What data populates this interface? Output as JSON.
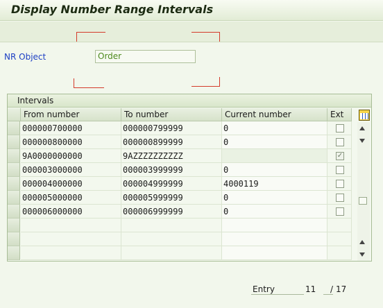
{
  "window": {
    "title": "Display Number Range Intervals"
  },
  "form": {
    "nr_object_label": "NR Object",
    "nr_object_value": "Order"
  },
  "intervals": {
    "panel_title": "Intervals",
    "columns": [
      "From number",
      "To number",
      "Current number",
      "Ext"
    ],
    "rows": [
      {
        "from": "000000700000",
        "to": "000000799999",
        "current": "0",
        "ext": false
      },
      {
        "from": "000000800000",
        "to": "000000899999",
        "current": "0",
        "ext": false
      },
      {
        "from": "9A0000000000",
        "to": "9AZZZZZZZZZZ",
        "current": "",
        "ext": true
      },
      {
        "from": "000003000000",
        "to": "000003999999",
        "current": "0",
        "ext": false
      },
      {
        "from": "000004000000",
        "to": "000004999999",
        "current": "4000119",
        "ext": false
      },
      {
        "from": "000005000000",
        "to": "000005999999",
        "current": "0",
        "ext": false
      },
      {
        "from": "000006000000",
        "to": "000006999999",
        "current": "0",
        "ext": false
      }
    ],
    "empty_rows": 3
  },
  "pager": {
    "label": "Entry",
    "current": "11",
    "separator": "/",
    "total": "17"
  },
  "colors": {
    "background": "#f2f7ec",
    "label_blue": "#1d3fc4",
    "value_green": "#4d8a1d",
    "marker_red": "#d43a2a"
  }
}
